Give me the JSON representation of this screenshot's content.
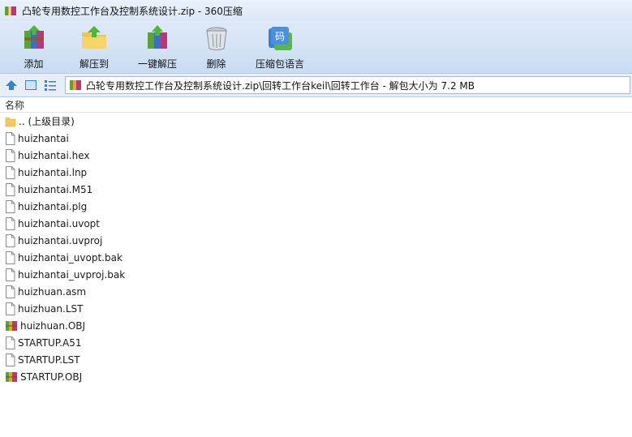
{
  "window": {
    "title": "凸轮专用数控工作台及控制系统设计.zip - 360压缩"
  },
  "toolbar": [
    {
      "label": "添加",
      "icon": "add-archive-icon"
    },
    {
      "label": "解压到",
      "icon": "extract-to-icon"
    },
    {
      "label": "一键解压",
      "icon": "one-click-extract-icon"
    },
    {
      "label": "删除",
      "icon": "delete-bin-icon"
    },
    {
      "label": "压缩包语言",
      "icon": "archive-language-icon"
    }
  ],
  "address": {
    "path": "凸轮专用数控工作台及控制系统设计.zip\\回转工作台keil\\回转工作台 - 解包大小为 7.2 MB"
  },
  "list": {
    "column_name": "名称",
    "files": [
      {
        "name": ".. (上级目录)",
        "type": "folder"
      },
      {
        "name": "huizhantai",
        "type": "file"
      },
      {
        "name": "huizhantai.hex",
        "type": "file"
      },
      {
        "name": "huizhantai.lnp",
        "type": "file"
      },
      {
        "name": "huizhantai.M51",
        "type": "file"
      },
      {
        "name": "huizhantai.plg",
        "type": "file"
      },
      {
        "name": "huizhantai.uvopt",
        "type": "file"
      },
      {
        "name": "huizhantai.uvproj",
        "type": "file"
      },
      {
        "name": "huizhantai_uvopt.bak",
        "type": "file"
      },
      {
        "name": "huizhantai_uvproj.bak",
        "type": "file"
      },
      {
        "name": "huizhuan.asm",
        "type": "file"
      },
      {
        "name": "huizhuan.LST",
        "type": "file"
      },
      {
        "name": "huizhuan.OBJ",
        "type": "archive"
      },
      {
        "name": "STARTUP.A51",
        "type": "file"
      },
      {
        "name": "STARTUP.LST",
        "type": "file"
      },
      {
        "name": "STARTUP.OBJ",
        "type": "archive"
      }
    ]
  },
  "colors": {
    "toolbar_bg": "#c9dcf3",
    "nav_blue": "#3a7fd0",
    "folder": "#f6c85a"
  }
}
